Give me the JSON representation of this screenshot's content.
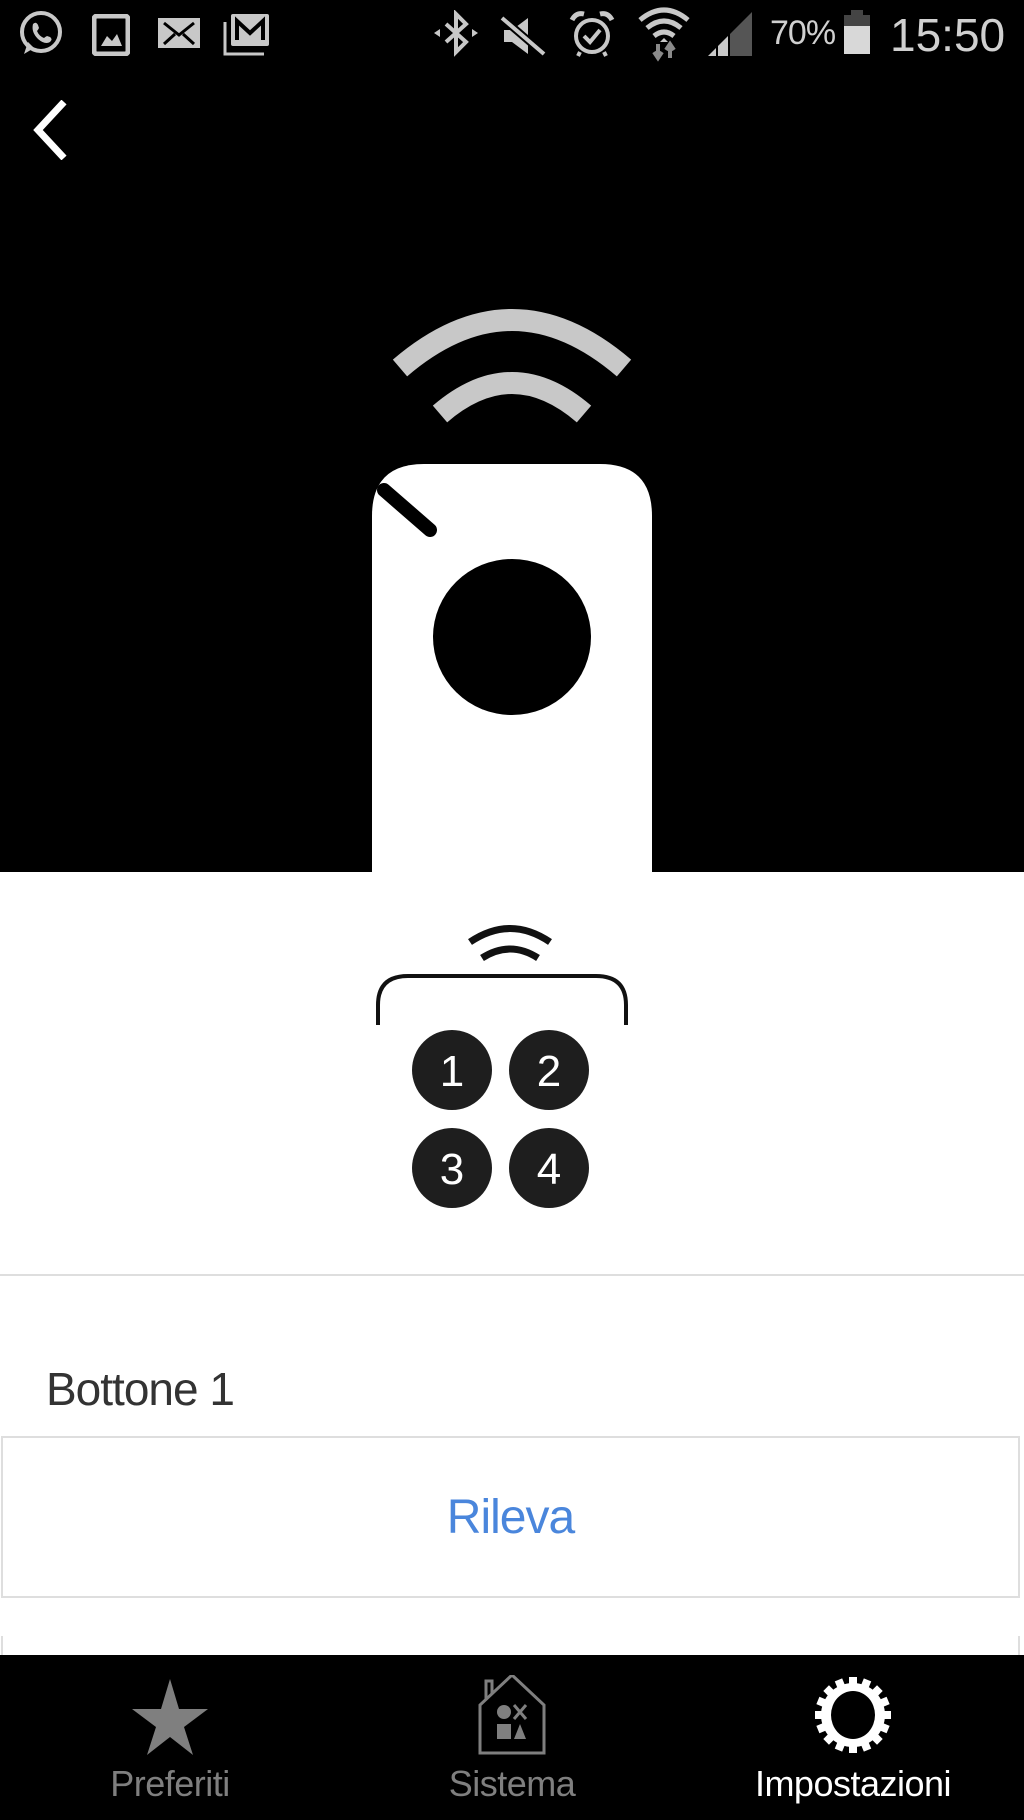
{
  "status_bar": {
    "left_icons": [
      "whatsapp-icon",
      "gallery-icon",
      "email-icon",
      "gmail-icon"
    ],
    "right_icons": [
      "bluetooth-icon",
      "mute-icon",
      "alarm-icon",
      "wifi-icon",
      "signal-icon",
      "battery-icon"
    ],
    "battery_percent": "70%",
    "time": "15:50"
  },
  "header": {
    "back_icon": "chevron-left-icon"
  },
  "illustration": {
    "remote_icon": "remote-control-icon",
    "receiver_icon": "four-button-receiver-icon",
    "receiver_buttons": [
      "1",
      "2",
      "3",
      "4"
    ]
  },
  "settings": {
    "field_label": "Bottone 1",
    "detect_button": "Rileva"
  },
  "colors": {
    "accent": "#4a86dc",
    "tab_active": "#ffffff",
    "tab_inactive": "#7f7f7f"
  },
  "tabbar": {
    "items": [
      {
        "label": "Preferiti",
        "icon": "star-icon",
        "active": false
      },
      {
        "label": "Sistema",
        "icon": "house-icon",
        "active": false
      },
      {
        "label": "Impostazioni",
        "icon": "gear-icon",
        "active": true
      }
    ]
  }
}
